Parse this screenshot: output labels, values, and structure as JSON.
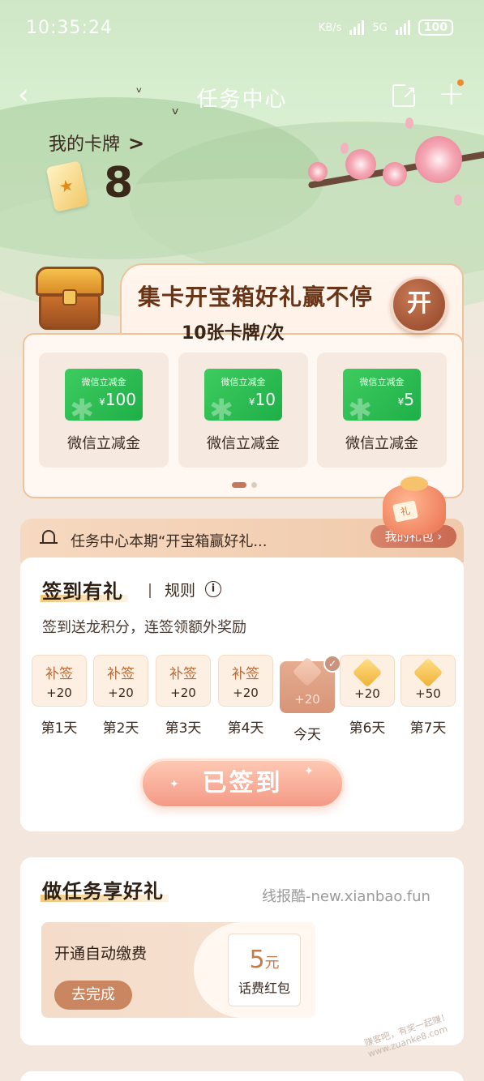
{
  "status_bar": {
    "time": "10:35:24",
    "net_speed": "KB/s",
    "signal_5g": "5G",
    "battery": "100"
  },
  "nav": {
    "title": "任务中心",
    "back_glyph": "‹",
    "plus_glyph": "+"
  },
  "my_cards": {
    "label": "我的卡牌",
    "arrow": ">",
    "count": "8"
  },
  "treasure": {
    "title": "集卡开宝箱好礼赢不停",
    "subtitle": "10张卡牌/次",
    "open_label": "开",
    "rewards": [
      {
        "coupon_title": "微信立减金",
        "currency": "¥",
        "amount": "100",
        "label": "微信立减金"
      },
      {
        "coupon_title": "微信立减金",
        "currency": "¥",
        "amount": "10",
        "label": "微信立减金"
      },
      {
        "coupon_title": "微信立减金",
        "currency": "¥",
        "amount": "5",
        "label": "微信立减金"
      }
    ],
    "page_index": 1,
    "page_count": 2
  },
  "notice": {
    "text": "任务中心本期“开宝箱赢好礼...",
    "my_gift_label": "我的礼包 ›"
  },
  "signin": {
    "title": "签到有礼",
    "rules_label": "规则",
    "description": "签到送龙积分，连签领额外奖励",
    "days": [
      {
        "top": "补签",
        "points": "+20",
        "label": "第1天",
        "state": "makeup"
      },
      {
        "top": "补签",
        "points": "+20",
        "label": "第2天",
        "state": "makeup"
      },
      {
        "top": "补签",
        "points": "+20",
        "label": "第3天",
        "state": "makeup"
      },
      {
        "top": "补签",
        "points": "+20",
        "label": "第4天",
        "state": "makeup"
      },
      {
        "top": "",
        "points": "+20",
        "label": "今天",
        "state": "signed"
      },
      {
        "top": "",
        "points": "+20",
        "label": "第6天",
        "state": "upcoming"
      },
      {
        "top": "",
        "points": "+50",
        "label": "第7天",
        "state": "upcoming"
      }
    ],
    "button_label": "已签到"
  },
  "tasks": {
    "title": "做任务享好礼",
    "watermark": "线报酷-new.xianbao.fun",
    "items": [
      {
        "name": "开通自动缴费",
        "action": "去完成",
        "prize_value": "5",
        "prize_unit": "元",
        "prize_label": "话费红包"
      }
    ]
  },
  "stamp_text": "赚客吧，有奖一起赚！www.zuanke8.com",
  "colors": {
    "accent": "#c98660",
    "brown_title": "#6a3416",
    "coupon_green": "#2cbd54",
    "page_bg": "#f3e7dd"
  }
}
